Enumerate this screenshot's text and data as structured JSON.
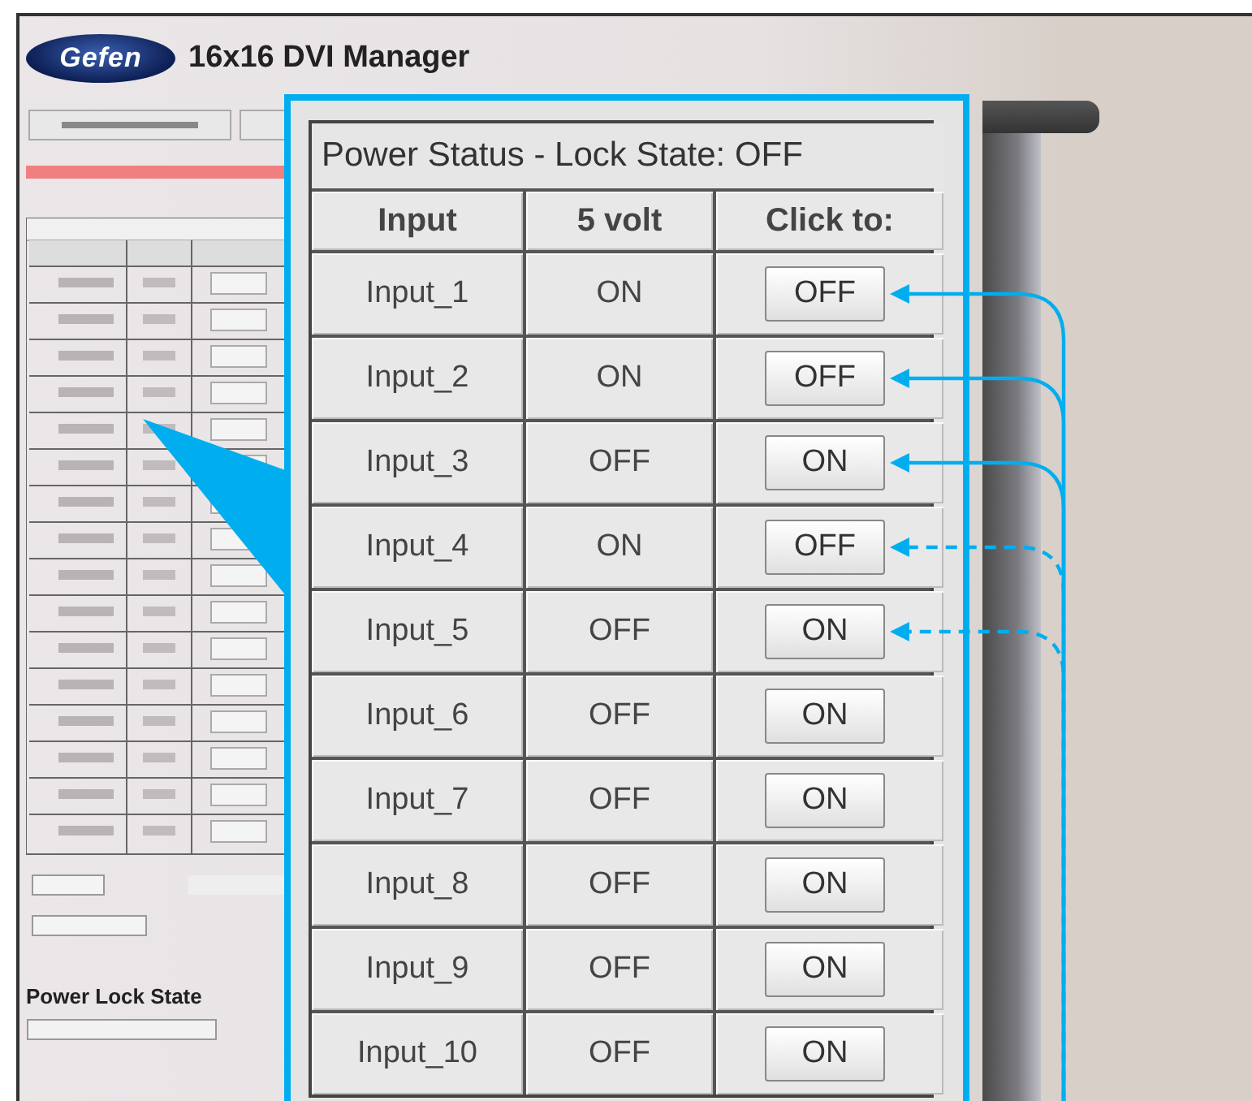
{
  "header": {
    "logo": "Gefen",
    "title": "16x16 DVI Manager"
  },
  "background": {
    "section_title": "Power Lock State"
  },
  "callout": {
    "title": "Power Status - Lock State: OFF",
    "columns": [
      "Input",
      "5 volt",
      "Click to:"
    ],
    "rows": [
      {
        "kind": "solid",
        "input": "Input_1",
        "volt": "ON",
        "action": "OFF"
      },
      {
        "kind": "solid",
        "input": "Input_2",
        "volt": "ON",
        "action": "OFF"
      },
      {
        "kind": "solid",
        "input": "Input_3",
        "volt": "OFF",
        "action": "ON"
      },
      {
        "kind": "dashed",
        "input": "Input_4",
        "volt": "ON",
        "action": "OFF"
      },
      {
        "kind": "dashed",
        "input": "Input_5",
        "volt": "OFF",
        "action": "ON"
      },
      {
        "kind": "plain",
        "input": "Input_6",
        "volt": "OFF",
        "action": "ON"
      },
      {
        "kind": "plain",
        "input": "Input_7",
        "volt": "OFF",
        "action": "ON"
      },
      {
        "kind": "plain",
        "input": "Input_8",
        "volt": "OFF",
        "action": "ON"
      },
      {
        "kind": "plain",
        "input": "Input_9",
        "volt": "OFF",
        "action": "ON"
      },
      {
        "kind": "plain",
        "input": "Input_10",
        "volt": "OFF",
        "action": "ON"
      }
    ]
  }
}
